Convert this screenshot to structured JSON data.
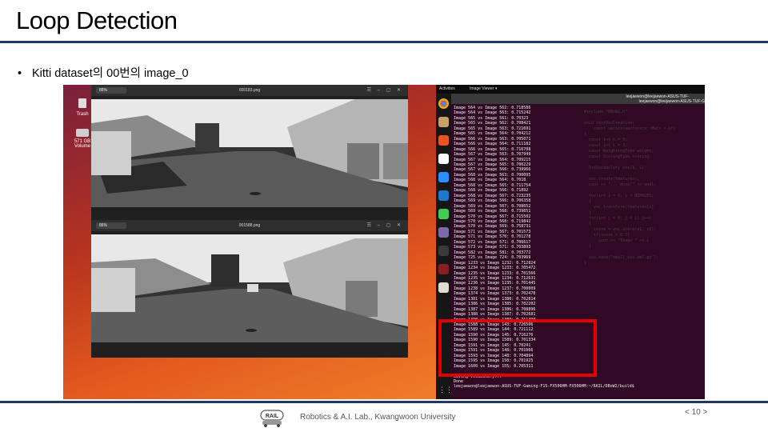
{
  "slide": {
    "title": "Loop Detection",
    "bullet": "Kitti dataset의 00번의 image_0",
    "footer": "Robotics & A.I. Lab., Kwangwoon University",
    "logo_text": "RAIL",
    "page_number": "< 10 >",
    "colors": {
      "rule": "#1f3864",
      "highlight": "#e00000"
    }
  },
  "desktop": {
    "trash_label": "Trash",
    "volume_label": "571 GB Volume"
  },
  "viewer1": {
    "zoom": "86%",
    "filename": "000183.png"
  },
  "viewer2": {
    "zoom": "86%",
    "filename": "001588.png"
  },
  "topbar": {
    "activities": "Activities",
    "app": "Image Viewer ▾"
  },
  "terminal": {
    "title_user": "leejaewon@leejaewon-ASUS-TUF-",
    "title_user2": "leejaewon@leejaewon-ASUS-TUF-G",
    "output": "Image 564 vs Image 562: 0.718586\nImage 564 vs Image 563: 0.715242\nImage 565 vs Image 561: 0.70323\nImage 565 vs Image 562: 0.708421\nImage 565 vs Image 563: 0.721691\nImage 565 vs Image 564: 0.704212\nImage 566 vs Image 563: 0.705071\nImage 566 vs Image 564: 0.711182\nImage 566 vs Image 565: 0.716708\nImage 567 vs Image 563: 0.707949\nImage 567 vs Image 564: 0.709215\nImage 567 vs Image 565: 0.706229\nImage 567 vs Image 566: 0.739966\nImage 568 vs Image 563: 0.700095\nImage 568 vs Image 564: 0.7018\nImage 568 vs Image 565: 0.711754\nImage 568 vs Image 566: 0.71892\nImage 568 vs Image 567: 0.723235\nImage 569 vs Image 566: 0.706358\nImage 569 vs Image 567: 0.708652\nImage 569 vs Image 568: 0.739651\nImage 570 vs Image 567: 0.715502\nImage 570 vs Image 568: 0.719842\nImage 570 vs Image 569: 0.758731\nImage 571 vs Image 567: 0.701573\nImage 571 vs Image 570: 0.701278\nImage 572 vs Image 571: 0.706617\nImage 573 vs Image 571: 0.703893\nImage 582 vs Image 581: 0.703772\nImage 725 vs Image 724: 0.703969\nImage 1233 vs Image 1232: 0.712824\nImage 1234 vs Image 1233: 0.705472\nImage 1235 vs Image 1233: 0.701566\nImage 1235 vs Image 1234: 0.712631\nImage 1236 vs Image 1235: 0.701445\nImage 1238 vs Image 1237: 0.700009\nImage 1374 vs Image 1373: 0.702478\nImage 1381 vs Image 1380: 0.702814\nImage 1386 vs Image 1385: 0.702202\nImage 1387 vs Image 1386: 0.708896\nImage 1388 vs Image 1387: 0.702681\nImage 1390 vs Image 1389: 0.711490\nImage 1588 vs Image 143: 0.726506\nImage 1589 vs Image 144: 0.721112\nImage 1590 vs Image 145: 0.716276\nImage 1590 vs Image 1589: 0.701334\nImage 1591 vs Image 145: 0.70241\nImage 1591 vs Image 148: 0.701066\nImage 1593 vs Image 148: 0.704894\nImage 1595 vs Image 150: 0.701925\nImage 1600 vs Image 155: 0.705311\n\nSaving vocabulary...\nDone\nleejaewon@leejaewon-ASUS-TUF-Gaming-F15-FX506HM-FX506HM:~/RAIL/DBoW2/build$ "
  }
}
